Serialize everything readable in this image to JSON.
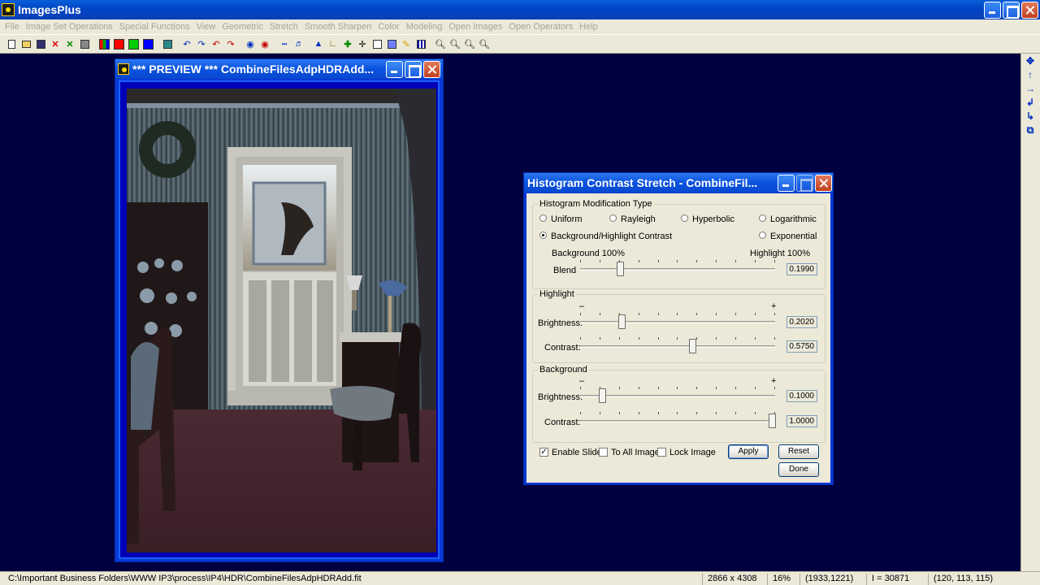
{
  "app": {
    "title": "ImagesPlus"
  },
  "menu": [
    "File",
    "Image Set Operations",
    "Special Functions",
    "View",
    "Geometric",
    "Stretch",
    "Smooth Sharpen",
    "Color",
    "Modeling",
    "Open Images",
    "Open Operators",
    "Help"
  ],
  "preview": {
    "title": "*** PREVIEW *** CombineFilesAdpHDRAdd..."
  },
  "dialog": {
    "title": "Histogram Contrast Stretch - CombineFil...",
    "mod_type": {
      "label": "Histogram Modification Type",
      "uniform": "Uniform",
      "rayleigh": "Rayleigh",
      "hyperbolic": "Hyperbolic",
      "logarithmic": "Logarithmic",
      "bg_highlight": "Background/Highlight Contrast",
      "exponential": "Exponential",
      "selected": "Background/Highlight Contrast",
      "bg_label": "Background 100%",
      "hl_label": "Highlight 100%",
      "blend_label": "Blend",
      "blend_value": "0.1990"
    },
    "highlight": {
      "label": "Highlight",
      "minus": "–",
      "plus": "+",
      "brightness_label": "Brightness:",
      "brightness_value": "0.2020",
      "contrast_label": "Contrast:",
      "contrast_value": "0.5750"
    },
    "background": {
      "label": "Background",
      "minus": "–",
      "plus": "+",
      "brightness_label": "Brightness:",
      "brightness_value": "0.1000",
      "contrast_label": "Contrast:",
      "contrast_value": "1.0000"
    },
    "enable_slider": "Enable Slider",
    "to_all_images": "To All Images",
    "lock_image": "Lock Image",
    "apply": "Apply",
    "reset": "Reset",
    "done": "Done"
  },
  "status": {
    "path": "C:\\Important Business Folders\\WWW IP3\\process\\IP4\\HDR\\CombineFilesAdpHDRAdd.fit",
    "dimensions": "2866 x 4308",
    "zoom": "16%",
    "coords": "(1933,1221)",
    "intensity": "I = 30871",
    "rgb": "(120, 113, 115)"
  }
}
